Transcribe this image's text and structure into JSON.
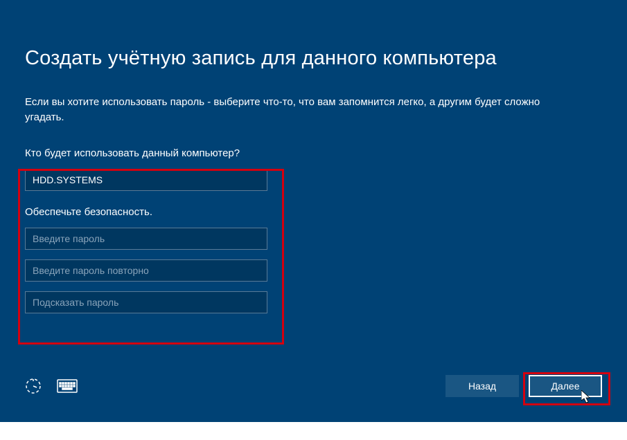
{
  "title": "Создать учётную запись для данного компьютера",
  "description": "Если вы хотите использовать пароль - выберите что-то, что вам запомнится легко, а другим будет сложно угадать.",
  "who_label": "Кто будет использовать данный компьютер?",
  "username_value": "HDD.SYSTEMS",
  "secure_label": "Обеспечьте безопасность.",
  "password_placeholder": "Введите пароль",
  "password_confirm_placeholder": "Введите пароль повторно",
  "password_hint_placeholder": "Подсказать пароль",
  "back_label": "Назад",
  "next_label": "Далее"
}
